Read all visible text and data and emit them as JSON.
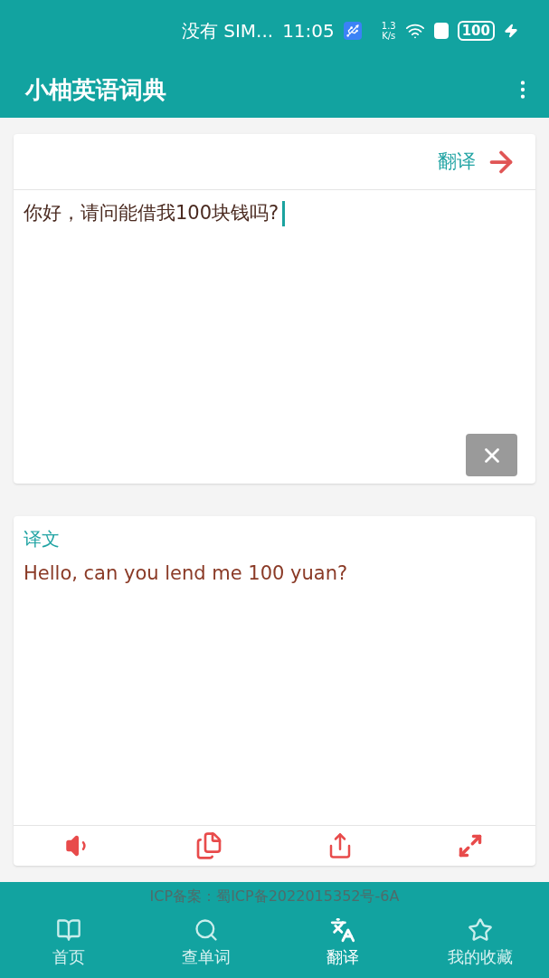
{
  "status_bar": {
    "carrier": "没有 SIM...",
    "time": "11:05",
    "net_speed_value": "1.3",
    "net_speed_unit": "K/s",
    "battery": "100"
  },
  "app_bar": {
    "title": "小柚英语词典"
  },
  "input_card": {
    "translate_button": "翻译",
    "text": "你好，请问能借我100块钱吗?"
  },
  "output_card": {
    "heading": "译文",
    "text": "Hello, can you lend me 100 yuan?"
  },
  "footer": {
    "icp": "ICP备案：蜀ICP备2022015352号-6A"
  },
  "nav": [
    {
      "kind": "home",
      "label": "首页",
      "selected": false
    },
    {
      "kind": "search",
      "label": "查单词",
      "selected": false
    },
    {
      "kind": "translate",
      "label": "翻译",
      "selected": true
    },
    {
      "kind": "favorites",
      "label": "我的收藏",
      "selected": false
    }
  ]
}
